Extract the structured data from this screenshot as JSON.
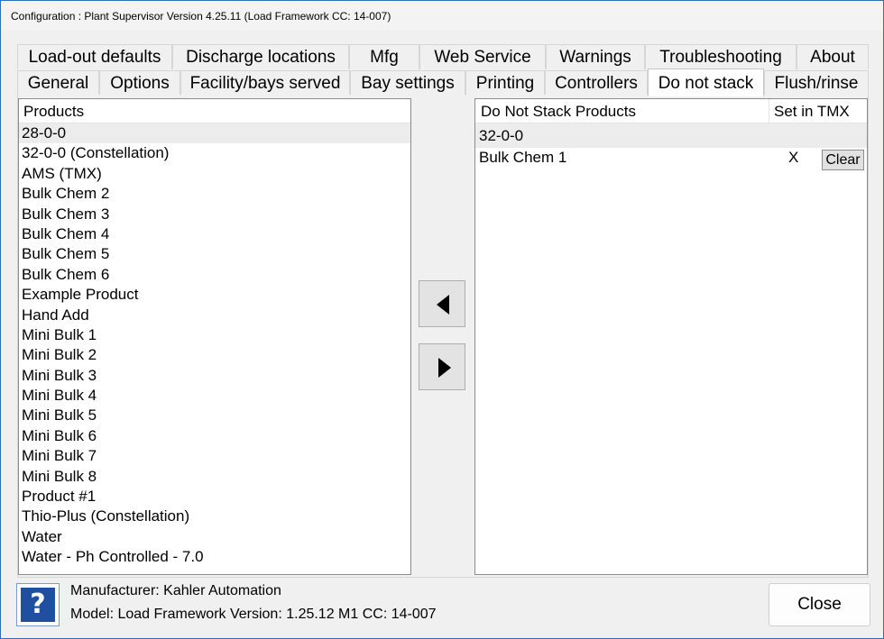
{
  "window": {
    "title": "Configuration : Plant Supervisor Version 4.25.11 (Load Framework CC: 14-007)"
  },
  "tabs_row1": [
    "Load-out defaults",
    "Discharge locations",
    "Mfg",
    "Web Service",
    "Warnings",
    "Troubleshooting",
    "About"
  ],
  "tabs_row2": [
    "General",
    "Options",
    "Facility/bays served",
    "Bay settings",
    "Printing",
    "Controllers",
    "Do not stack",
    "Flush/rinse"
  ],
  "active_tab": "Do not stack",
  "products": {
    "header": "Products",
    "items": [
      "28-0-0",
      "32-0-0 (Constellation)",
      "AMS (TMX)",
      "Bulk Chem 2",
      "Bulk Chem 3",
      "Bulk Chem 4",
      "Bulk Chem 5",
      "Bulk Chem 6",
      "Example Product",
      "Hand Add",
      "Mini Bulk 1",
      "Mini Bulk 2",
      "Mini Bulk 3",
      "Mini Bulk 4",
      "Mini Bulk 5",
      "Mini Bulk 6",
      "Mini Bulk 7",
      "Mini Bulk 8",
      "Product #1",
      "Thio-Plus (Constellation)",
      "Water",
      "Water - Ph Controlled - 7.0"
    ],
    "selected": "28-0-0"
  },
  "do_not_stack": {
    "header_products": "Do Not Stack Products",
    "header_tmx": "Set in TMX",
    "group": "32-0-0",
    "rows": [
      {
        "product": "Bulk Chem 1",
        "tmx": "X",
        "button": "Clear"
      }
    ]
  },
  "arrows": {
    "left": "left-arrow-icon",
    "right": "right-arrow-icon"
  },
  "footer": {
    "manufacturer": "Manufacturer: Kahler Automation",
    "model": "Model: Load Framework Version: 1.25.12 M1 CC: 14-007",
    "help_glyph": "?",
    "close_label": "Close"
  },
  "colors": {
    "accent": "#1f4f9e",
    "window_border": "#2f6fb8"
  }
}
